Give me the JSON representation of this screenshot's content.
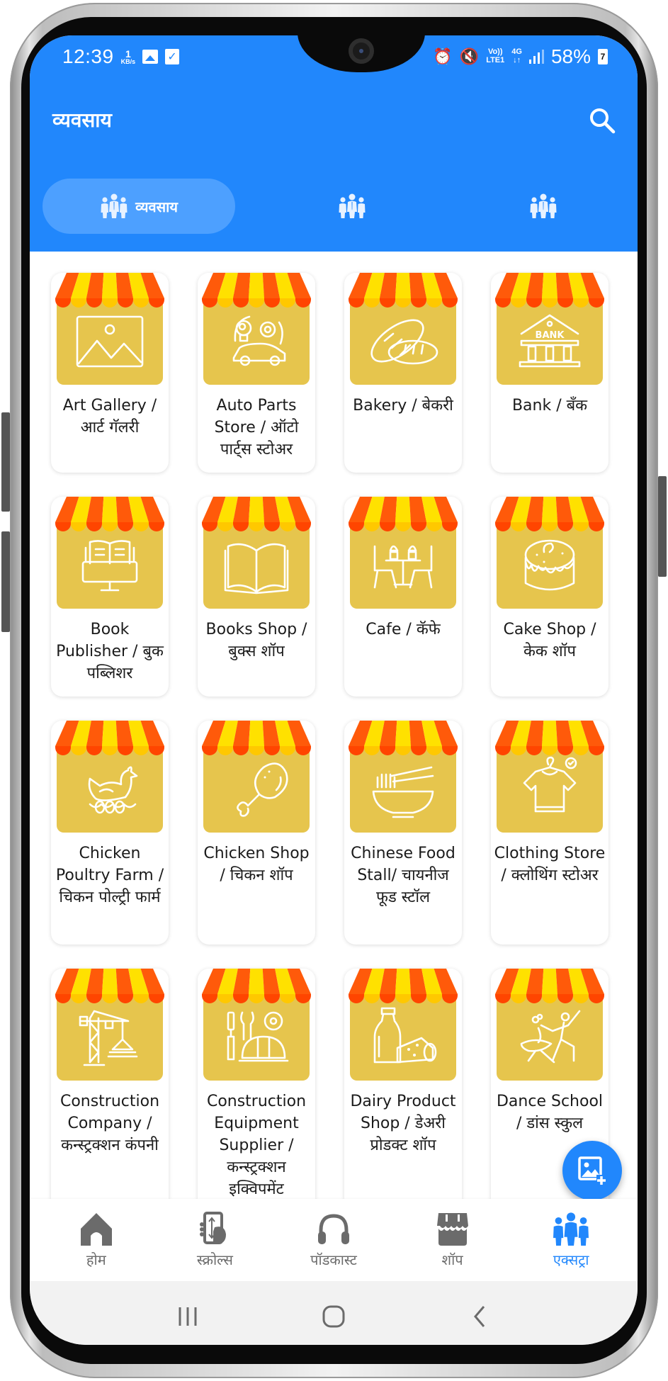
{
  "status_bar": {
    "time": "12:39",
    "net_speed_value": "1",
    "net_speed_unit": "KB/s",
    "volte": "Vo))",
    "lte": "LTE1",
    "network": "4G",
    "arrows": "↓↑",
    "battery_percent": "58%",
    "battery_glyph": "7"
  },
  "app_bar": {
    "title": "व्यवसाय"
  },
  "tabs": [
    {
      "label": "व्यवसाय",
      "icon": "people-group-icon",
      "selected": true
    },
    {
      "label": "",
      "icon": "people-group-icon",
      "selected": false
    },
    {
      "label": "",
      "icon": "people-group-icon",
      "selected": false
    }
  ],
  "colors": {
    "primary": "#2187fc",
    "tab_selected_bg": "#4da0ff",
    "awning_orange": "#ff5a0a",
    "awning_yellow": "#ffe100",
    "shop_body": "#e6c54d",
    "nav_inactive": "#6b6b6b"
  },
  "categories": [
    {
      "label": "Art Gallery / आर्ट गॅलरी",
      "icon": "picture-icon"
    },
    {
      "label": "Auto Parts Store / ऑटो पार्ट्स स्टोअर",
      "icon": "car-parts-icon"
    },
    {
      "label": "Bakery / बेकरी",
      "icon": "bread-icon"
    },
    {
      "label": "Bank / बँक",
      "icon": "bank-icon"
    },
    {
      "label": "Book Publisher / बुक पब्लिशर",
      "icon": "ebook-monitor-icon"
    },
    {
      "label": "Books Shop / बुक्स शॉप",
      "icon": "open-book-icon"
    },
    {
      "label": "Cafe / कॅफे",
      "icon": "cafe-table-icon"
    },
    {
      "label": "Cake Shop / केक शॉप",
      "icon": "cake-icon"
    },
    {
      "label": "Chicken Poultry Farm / चिकन पोल्ट्री फार्म",
      "icon": "hen-icon"
    },
    {
      "label": "Chicken Shop / चिकन शॉप",
      "icon": "chicken-leg-icon"
    },
    {
      "label": "Chinese Food Stall/ चायनीज फूड स्टॉल",
      "icon": "noodles-bowl-icon"
    },
    {
      "label": "Clothing Store / क्लोथिंग स्टोअर",
      "icon": "tshirt-hanger-icon"
    },
    {
      "label": "Construction Company / कन्स्ट्रक्शन कंपनी",
      "icon": "crane-icon"
    },
    {
      "label": "Construction Equipment Supplier / कन्स्ट्रक्शन इक्विपमेंट",
      "icon": "tools-helmet-icon"
    },
    {
      "label": "Dairy Product Shop / डेअरी प्रोडक्ट शॉप",
      "icon": "milk-cheese-icon"
    },
    {
      "label": "Dance School / डांस स्कुल",
      "icon": "dancers-icon"
    }
  ],
  "fab": {
    "icon": "add-photo-icon"
  },
  "bottom_nav": [
    {
      "label": "होम",
      "icon": "home-icon",
      "active": false
    },
    {
      "label": "स्क्रोल्स",
      "icon": "scroll-phone-icon",
      "active": false
    },
    {
      "label": "पॉडकास्ट",
      "icon": "headphones-icon",
      "active": false
    },
    {
      "label": "शॉप",
      "icon": "shop-icon",
      "active": false
    },
    {
      "label": "एक्सट्रा",
      "icon": "people-group-icon",
      "active": true
    }
  ],
  "system_nav": [
    {
      "icon": "recents-icon"
    },
    {
      "icon": "home-circle-icon"
    },
    {
      "icon": "back-icon"
    }
  ]
}
